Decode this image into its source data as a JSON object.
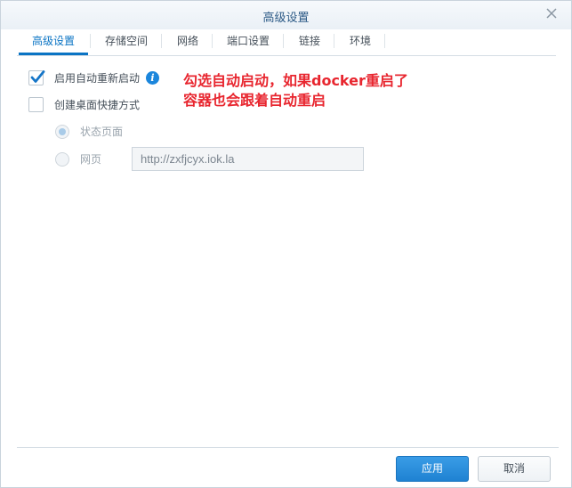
{
  "dialog": {
    "title": "高级设置"
  },
  "tabs": [
    {
      "label": "高级设置",
      "active": true
    },
    {
      "label": "存储空间",
      "active": false
    },
    {
      "label": "网络",
      "active": false
    },
    {
      "label": "端口设置",
      "active": false
    },
    {
      "label": "链接",
      "active": false
    },
    {
      "label": "环境",
      "active": false
    }
  ],
  "options": {
    "auto_restart_label": "启用自动重新启动",
    "auto_restart_checked": true,
    "desktop_shortcut_label": "创建桌面快捷方式",
    "desktop_shortcut_checked": false,
    "status_page_label": "状态页面",
    "webpage_label": "网页",
    "url_value": "http://zxfjcyx.iok.la"
  },
  "annotation": {
    "line1": "勾选自动启动，如果docker重启了",
    "line2": "容器也会跟着自动重启"
  },
  "footer": {
    "apply_label": "应用",
    "cancel_label": "取消"
  },
  "colors": {
    "accent": "#0b74c4",
    "annotation": "#e8262f",
    "primary_button": "#1f82d2"
  }
}
